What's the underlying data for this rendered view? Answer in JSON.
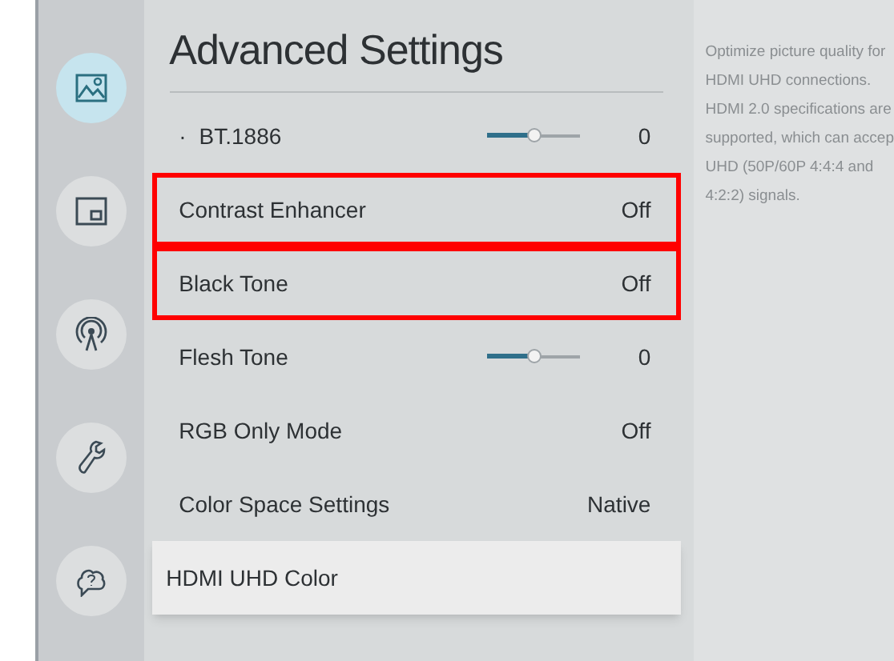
{
  "sidebar": {
    "items": [
      {
        "kind": "picture",
        "selected": true
      },
      {
        "kind": "screen",
        "selected": false
      },
      {
        "kind": "broadcast",
        "selected": false
      },
      {
        "kind": "wrench",
        "selected": false
      },
      {
        "kind": "help",
        "selected": false
      }
    ]
  },
  "panel": {
    "title": "Advanced Settings",
    "rows": [
      {
        "kind": "slider",
        "bullet": "·",
        "label": "BT.1886",
        "level": 0.5,
        "value": "0",
        "highlighted": false,
        "focused": false
      },
      {
        "kind": "value",
        "label": "Contrast Enhancer",
        "value": "Off",
        "highlighted": true,
        "focused": false
      },
      {
        "kind": "value",
        "label": "Black Tone",
        "value": "Off",
        "highlighted": true,
        "focused": false
      },
      {
        "kind": "slider",
        "label": "Flesh Tone",
        "level": 0.5,
        "value": "0",
        "highlighted": false,
        "focused": false
      },
      {
        "kind": "value",
        "label": "RGB Only Mode",
        "value": "Off",
        "highlighted": false,
        "focused": false
      },
      {
        "kind": "value",
        "label": "Color Space Settings",
        "value": "Native",
        "highlighted": false,
        "focused": false
      },
      {
        "kind": "value",
        "label": "HDMI UHD Color",
        "highlighted": false,
        "focused": true
      }
    ]
  },
  "help": {
    "lines": [
      "Optimize picture quality for",
      "HDMI UHD connections.",
      "HDMI 2.0 specifications are",
      "supported, which can accep",
      "UHD (50P/60P 4:4:4 and",
      "4:2:2) signals."
    ]
  }
}
